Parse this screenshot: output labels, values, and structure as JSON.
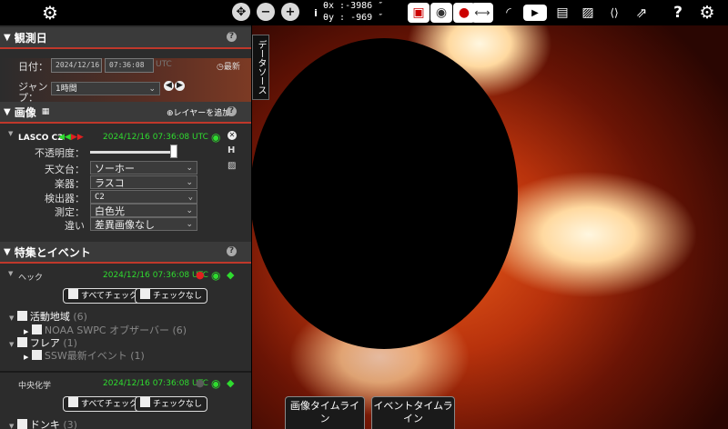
{
  "toolbar": {
    "settings_icon": "gear-icon",
    "zoom_fit_icon": "crosshair-icon",
    "zoom_out": "−",
    "zoom_in": "+",
    "info": "i",
    "coords": {
      "x_label": "θx :",
      "x_value": "-3986",
      "y_label": "θy :",
      "y_value": "-969",
      "x_unit": "″",
      "y_unit": "″"
    },
    "help": "?"
  },
  "observation_date": {
    "title": "観測日",
    "date_label": "日付：",
    "date_value": "2024/12/16",
    "time_value": "07:36:08",
    "tz": "UTC",
    "latest": "最新",
    "jump_label": "ジャン\nプ：",
    "jump_value": "1時間"
  },
  "images": {
    "title": "画像",
    "add_layer": "レイヤーを追加",
    "layer_name": "LASCO C2",
    "layer_time": "2024/12/16 07:36:08 UTC",
    "opacity_label": "不透明度：",
    "observatory_label": "天文台：",
    "observatory_value": "ソーホー",
    "instrument_label": "楽器：",
    "instrument_value": "ラスコ",
    "detector_label": "検出器：",
    "detector_value": "C2",
    "measurement_label": "測定：",
    "measurement_value": "白色光",
    "difference_label": "違い",
    "difference_value": "差異画像なし"
  },
  "features": {
    "title": "特集とイベント",
    "groups": [
      {
        "name": "ヘック",
        "time": "2024/12/16 07:36:08 UTC",
        "check_all": "すべてチェック",
        "check_none": "チェックなし"
      },
      {
        "name": "中央化学",
        "time": "2024/12/16 07:36:08 UTC",
        "check_all": "すべてチェック",
        "check_none": "チェックなし"
      }
    ],
    "tree": {
      "active_region": "活動地域",
      "active_region_count": "(6)",
      "noaa": "NOAA SWPC オブザーバー",
      "noaa_count": "(6)",
      "flare": "フレア",
      "flare_count": "(1)",
      "ssw": "SSW最新イベント",
      "ssw_count": "(1)",
      "donki": "ドンキ",
      "donki_count": "(3)"
    }
  },
  "side_tab": "データソース",
  "bottom_tabs": [
    "画像タイムライ\nン",
    "イベントタイムラ\nイン"
  ]
}
